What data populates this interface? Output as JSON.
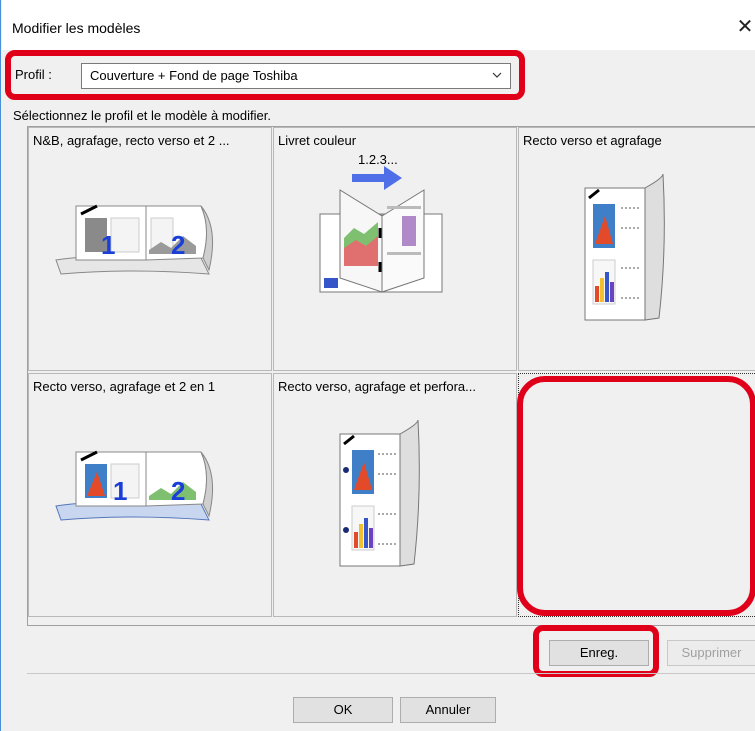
{
  "window": {
    "title": "Modifier les modèles"
  },
  "profile": {
    "label": "Profil :",
    "selected": "Couverture + Fond de page Toshiba"
  },
  "instruction": "Sélectionnez le profil et le modèle à modifier.",
  "templates": [
    {
      "label": "N&B, agrafage, recto verso et 2 ...",
      "icon": "booklet-2in1-bw-icon"
    },
    {
      "label": "Livret couleur",
      "icon": "color-booklet-icon",
      "pagination": "1.2.3..."
    },
    {
      "label": "Recto verso et agrafage",
      "icon": "duplex-staple-icon"
    },
    {
      "label": "Recto verso, agrafage et 2 en 1",
      "icon": "duplex-staple-2in1-icon"
    },
    {
      "label": "Recto verso, agrafage et perfora...",
      "icon": "duplex-staple-punch-icon"
    },
    {
      "label": "",
      "icon": ""
    }
  ],
  "buttons": {
    "save": "Enreg.",
    "delete": "Supprimer",
    "ok": "OK",
    "cancel": "Annuler"
  },
  "colors": {
    "highlight": "#e0001a",
    "arrow": "#4f6fe8"
  }
}
